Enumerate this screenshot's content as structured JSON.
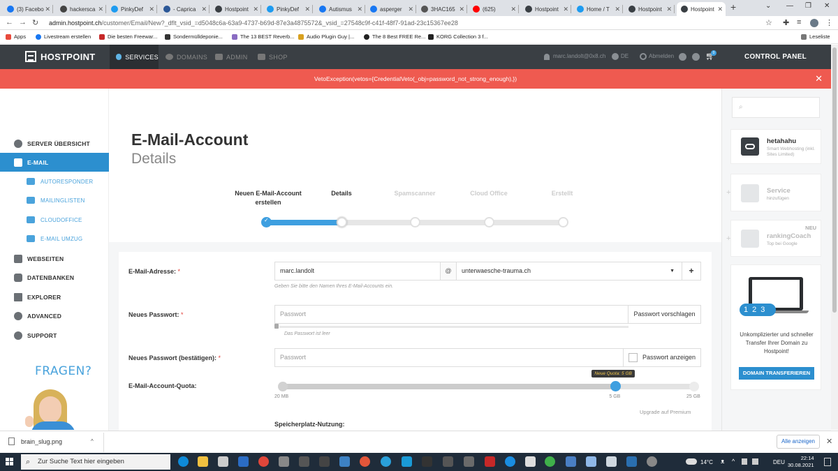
{
  "browser": {
    "tabs": [
      {
        "label": "(3) Facebo",
        "color": "#1877f2"
      },
      {
        "label": "hackersca",
        "color": "#444444"
      },
      {
        "label": "PinkyDef",
        "color": "#1d9bf0"
      },
      {
        "label": "- Caprica",
        "color": "#2b5797"
      },
      {
        "label": "Hostpoint",
        "color": "#3a3f44"
      },
      {
        "label": "PinkyDef",
        "color": "#1d9bf0"
      },
      {
        "label": "Autismus",
        "color": "#1877f2"
      },
      {
        "label": "asperger",
        "color": "#1877f2"
      },
      {
        "label": "3HAC165",
        "color": "#555555"
      },
      {
        "label": "(625)",
        "color": "#ff0000"
      },
      {
        "label": "Hostpoint",
        "color": "#3a3f44"
      },
      {
        "label": "Home / T",
        "color": "#1d9bf0"
      },
      {
        "label": "Hostpoint",
        "color": "#3a3f44"
      },
      {
        "label": "Hostpoint",
        "color": "#3a3f44",
        "active": true
      }
    ],
    "url_host": "admin.hostpoint.ch",
    "url_path": "/customer/Email/New?_dflt_vsid_=d5048c6a-63a9-4737-b69d-87e3a4875572&_vsid_=27548c9f-c41f-48f7-91ad-23c15367ee28",
    "bookmarks": [
      "Apps",
      "Livestream erstellen",
      "Die besten Freewar...",
      "Sondermülldeponie...",
      "The 13 BEST Reverb...",
      "Audio Plugin Guy |...",
      "The 8 Best FREE Re...",
      "KORG Collection 3 f..."
    ],
    "reading_list": "Leseliste"
  },
  "site": {
    "logo": "HOSTPOINT",
    "nav": [
      {
        "label": "SERVICES",
        "active": true
      },
      {
        "label": "DOMAINS"
      },
      {
        "label": "ADMIN"
      },
      {
        "label": "SHOP"
      }
    ],
    "user": "marc.landolt@0x8.ch",
    "lang": "DE",
    "logout": "Abmelden",
    "cart_count": "0",
    "control_panel": "CONTROL PANEL"
  },
  "error": {
    "message": "VetoException(vetos={CredentialVeto(_obj=password_not_strong_enough),})"
  },
  "sidebar": {
    "items": [
      {
        "label": "SERVER ÜBERSICHT"
      },
      {
        "label": "E-MAIL",
        "active": true
      },
      {
        "label": "WEBSEITEN"
      },
      {
        "label": "DATENBANKEN"
      },
      {
        "label": "EXPLORER"
      },
      {
        "label": "ADVANCED"
      },
      {
        "label": "SUPPORT"
      }
    ],
    "subitems": [
      {
        "label": "AUTORESPONDER"
      },
      {
        "label": "MAILINGLISTEN"
      },
      {
        "label": "CLOUDOFFICE"
      },
      {
        "label": "E-MAIL UMZUG"
      }
    ],
    "help_title": "FRAGEN?"
  },
  "page": {
    "title": "E-Mail-Account",
    "subtitle": "Details",
    "steps": [
      {
        "label": "Neuen E-Mail-Account erstellen",
        "state": "done"
      },
      {
        "label": "Details",
        "state": "current"
      },
      {
        "label": "Spamscanner",
        "state": "todo"
      },
      {
        "label": "Cloud Office",
        "state": "todo"
      },
      {
        "label": "Erstellt",
        "state": "todo"
      }
    ],
    "progress": 0.25
  },
  "form": {
    "email_label": "E-Mail-Adresse:",
    "email_value": "marc.landolt",
    "at_sign": "@",
    "domain_value": "unterwaesche-trauma.ch",
    "add_label": "+",
    "email_hint": "Geben Sie bitte den Namen Ihres E-Mail-Accounts ein.",
    "password_label": "Neues Passwort:",
    "password_placeholder": "Passwort",
    "suggest_label": "Passwort vorschlagen",
    "password_hint": "Das Passwort ist leer",
    "confirm_label": "Neues Passwort (bestätigen):",
    "confirm_placeholder": "Passwort",
    "show_label": "Passwort anzeigen",
    "quota_label": "E-Mail-Account-Quota:",
    "quota_tooltip": "Neue Quota: 5 GB",
    "quota_min": "20 MB",
    "quota_value": "5 GB",
    "quota_max": "25 GB",
    "quota_fraction": 0.8,
    "upgrade_label": "Upgrade auf Premium",
    "usage_label": "Speicherplatz-Nutzung:",
    "required_marker": "*"
  },
  "rpanel": {
    "account_title": "hetahahu",
    "account_sub": "Smart Webhosting (inkl. Sites Limited)",
    "service_title": "Service",
    "service_sub": "hinzufügen",
    "ranking_title": "rankingCoach",
    "ranking_sub": "Top bei Google",
    "ranking_badge": "NEU",
    "promo_steps": "123",
    "promo_text": "Unkomplizierter und schneller Transfer Ihrer Domain zu Hostpoint!",
    "promo_button": "DOMAIN TRANSFERIEREN"
  },
  "downloads": {
    "file": "brain_slug.png",
    "show_all": "Alle anzeigen"
  },
  "taskbar": {
    "search_placeholder": "Zur Suche Text hier eingeben",
    "weather": "14°C",
    "lang": "DEU",
    "time": "22:14",
    "date": "30.08.2021"
  }
}
